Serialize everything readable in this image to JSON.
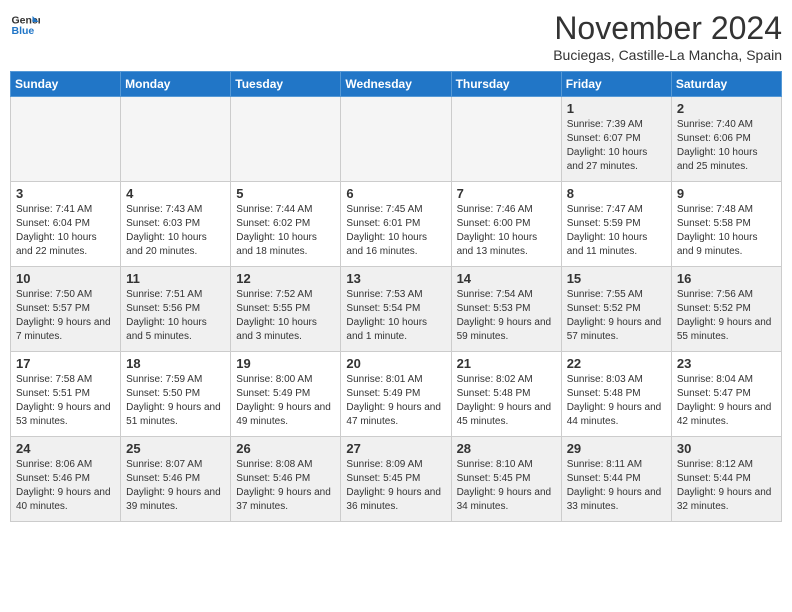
{
  "header": {
    "logo_line1": "General",
    "logo_line2": "Blue",
    "month": "November 2024",
    "location": "Buciegas, Castille-La Mancha, Spain"
  },
  "weekdays": [
    "Sunday",
    "Monday",
    "Tuesday",
    "Wednesday",
    "Thursday",
    "Friday",
    "Saturday"
  ],
  "weeks": [
    [
      {
        "day": "",
        "empty": true
      },
      {
        "day": "",
        "empty": true
      },
      {
        "day": "",
        "empty": true
      },
      {
        "day": "",
        "empty": true
      },
      {
        "day": "",
        "empty": true
      },
      {
        "day": "1",
        "sunrise": "7:39 AM",
        "sunset": "6:07 PM",
        "daylight": "10 hours and 27 minutes."
      },
      {
        "day": "2",
        "sunrise": "7:40 AM",
        "sunset": "6:06 PM",
        "daylight": "10 hours and 25 minutes."
      }
    ],
    [
      {
        "day": "3",
        "sunrise": "7:41 AM",
        "sunset": "6:04 PM",
        "daylight": "10 hours and 22 minutes."
      },
      {
        "day": "4",
        "sunrise": "7:43 AM",
        "sunset": "6:03 PM",
        "daylight": "10 hours and 20 minutes."
      },
      {
        "day": "5",
        "sunrise": "7:44 AM",
        "sunset": "6:02 PM",
        "daylight": "10 hours and 18 minutes."
      },
      {
        "day": "6",
        "sunrise": "7:45 AM",
        "sunset": "6:01 PM",
        "daylight": "10 hours and 16 minutes."
      },
      {
        "day": "7",
        "sunrise": "7:46 AM",
        "sunset": "6:00 PM",
        "daylight": "10 hours and 13 minutes."
      },
      {
        "day": "8",
        "sunrise": "7:47 AM",
        "sunset": "5:59 PM",
        "daylight": "10 hours and 11 minutes."
      },
      {
        "day": "9",
        "sunrise": "7:48 AM",
        "sunset": "5:58 PM",
        "daylight": "10 hours and 9 minutes."
      }
    ],
    [
      {
        "day": "10",
        "sunrise": "7:50 AM",
        "sunset": "5:57 PM",
        "daylight": "9 hours and 7 minutes."
      },
      {
        "day": "11",
        "sunrise": "7:51 AM",
        "sunset": "5:56 PM",
        "daylight": "10 hours and 5 minutes."
      },
      {
        "day": "12",
        "sunrise": "7:52 AM",
        "sunset": "5:55 PM",
        "daylight": "10 hours and 3 minutes."
      },
      {
        "day": "13",
        "sunrise": "7:53 AM",
        "sunset": "5:54 PM",
        "daylight": "10 hours and 1 minute."
      },
      {
        "day": "14",
        "sunrise": "7:54 AM",
        "sunset": "5:53 PM",
        "daylight": "9 hours and 59 minutes."
      },
      {
        "day": "15",
        "sunrise": "7:55 AM",
        "sunset": "5:52 PM",
        "daylight": "9 hours and 57 minutes."
      },
      {
        "day": "16",
        "sunrise": "7:56 AM",
        "sunset": "5:52 PM",
        "daylight": "9 hours and 55 minutes."
      }
    ],
    [
      {
        "day": "17",
        "sunrise": "7:58 AM",
        "sunset": "5:51 PM",
        "daylight": "9 hours and 53 minutes."
      },
      {
        "day": "18",
        "sunrise": "7:59 AM",
        "sunset": "5:50 PM",
        "daylight": "9 hours and 51 minutes."
      },
      {
        "day": "19",
        "sunrise": "8:00 AM",
        "sunset": "5:49 PM",
        "daylight": "9 hours and 49 minutes."
      },
      {
        "day": "20",
        "sunrise": "8:01 AM",
        "sunset": "5:49 PM",
        "daylight": "9 hours and 47 minutes."
      },
      {
        "day": "21",
        "sunrise": "8:02 AM",
        "sunset": "5:48 PM",
        "daylight": "9 hours and 45 minutes."
      },
      {
        "day": "22",
        "sunrise": "8:03 AM",
        "sunset": "5:48 PM",
        "daylight": "9 hours and 44 minutes."
      },
      {
        "day": "23",
        "sunrise": "8:04 AM",
        "sunset": "5:47 PM",
        "daylight": "9 hours and 42 minutes."
      }
    ],
    [
      {
        "day": "24",
        "sunrise": "8:06 AM",
        "sunset": "5:46 PM",
        "daylight": "9 hours and 40 minutes."
      },
      {
        "day": "25",
        "sunrise": "8:07 AM",
        "sunset": "5:46 PM",
        "daylight": "9 hours and 39 minutes."
      },
      {
        "day": "26",
        "sunrise": "8:08 AM",
        "sunset": "5:46 PM",
        "daylight": "9 hours and 37 minutes."
      },
      {
        "day": "27",
        "sunrise": "8:09 AM",
        "sunset": "5:45 PM",
        "daylight": "9 hours and 36 minutes."
      },
      {
        "day": "28",
        "sunrise": "8:10 AM",
        "sunset": "5:45 PM",
        "daylight": "9 hours and 34 minutes."
      },
      {
        "day": "29",
        "sunrise": "8:11 AM",
        "sunset": "5:44 PM",
        "daylight": "9 hours and 33 minutes."
      },
      {
        "day": "30",
        "sunrise": "8:12 AM",
        "sunset": "5:44 PM",
        "daylight": "9 hours and 32 minutes."
      }
    ]
  ]
}
